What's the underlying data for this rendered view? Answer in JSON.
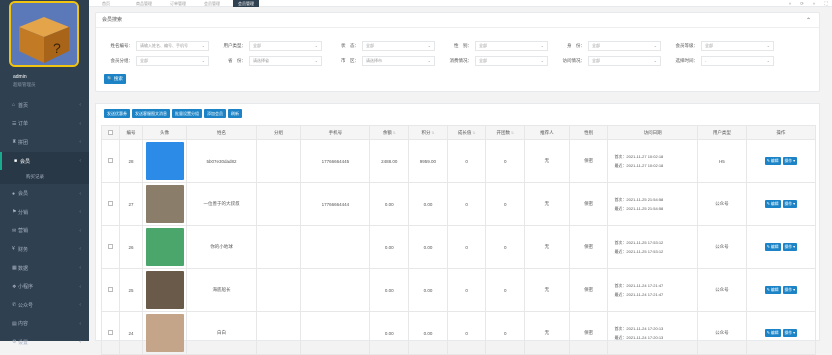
{
  "sidebar": {
    "username": "admin",
    "role": "超级管理员",
    "items": [
      {
        "label": "首页",
        "icon": "home-icon"
      },
      {
        "label": "订单",
        "icon": "order-icon"
      },
      {
        "label": "拼团",
        "icon": "group-icon"
      },
      {
        "label": "会员",
        "icon": "member-icon",
        "active": true
      },
      {
        "label": "会员",
        "icon": "user-icon"
      },
      {
        "label": "分销",
        "icon": "share-icon"
      },
      {
        "label": "营销",
        "icon": "marketing-icon"
      },
      {
        "label": "财务",
        "icon": "finance-icon"
      },
      {
        "label": "数据",
        "icon": "data-icon"
      },
      {
        "label": "小程序",
        "icon": "miniapp-icon"
      },
      {
        "label": "公众号",
        "icon": "wechat-icon"
      },
      {
        "label": "内容",
        "icon": "content-icon"
      },
      {
        "label": "设置",
        "icon": "settings-icon"
      }
    ],
    "subitem": "购买记录"
  },
  "tabs": [
    "首页",
    "商品管理",
    "订单管理",
    "会员管理",
    "会员管理"
  ],
  "search": {
    "title": "会员搜索",
    "row1": [
      {
        "label": "姓名编号：",
        "value": "请输入姓名、编号、手机号"
      },
      {
        "label": "用户类型：",
        "value": "全部"
      },
      {
        "label": "状　态：",
        "value": "全部"
      },
      {
        "label": "性　别：",
        "value": "全部"
      },
      {
        "label": "身　份：",
        "value": "全部"
      },
      {
        "label": "会员等级：",
        "value": "全部"
      }
    ],
    "row2": [
      {
        "label": "会员分组：",
        "value": "全部"
      },
      {
        "label": "省　份：",
        "value": "请选择省"
      },
      {
        "label": "市　区：",
        "value": "请选择市"
      },
      {
        "label": "消费情况：",
        "value": "全部"
      },
      {
        "label": "访问情况：",
        "value": "全部"
      },
      {
        "label": "选择时间：",
        "value": "-"
      }
    ],
    "button": "搜索"
  },
  "toolbar": [
    "发送优惠券",
    "发送客服图文消息",
    "批量设置分组",
    "添加会员",
    "刷新"
  ],
  "columns": [
    "",
    "编号",
    "头像",
    "姓名",
    "分组",
    "手机号",
    "余额",
    "积分",
    "成长值",
    "开团数",
    "推荐人",
    "性别",
    "访问日期",
    "用户类型",
    "操作"
  ],
  "rows": [
    {
      "id": "28",
      "name": "5b07e30dad82",
      "group": "",
      "phone": "17766664445",
      "balance": "2488.00",
      "points": "9959.00",
      "growth": "0",
      "groups": "0",
      "ref": "无",
      "gender": "保密",
      "first": "首次：2021-11-27 10:02:18",
      "last": "最近：2021-11-27 10:02:18",
      "type": "H5",
      "avatar": "#2b8be6"
    },
    {
      "id": "27",
      "name": "一位善于的大叔叔",
      "group": "",
      "phone": "17766664444",
      "balance": "0.00",
      "points": "0.00",
      "growth": "0",
      "groups": "0",
      "ref": "无",
      "gender": "保密",
      "first": "首次：2021-11-25 21:54:58",
      "last": "最近：2021-11-25 21:54:58",
      "type": "公众号",
      "avatar": "#8a7d6a"
    },
    {
      "id": "26",
      "name": "你的小地球",
      "group": "",
      "phone": "",
      "balance": "0.00",
      "points": "0.00",
      "growth": "0",
      "groups": "0",
      "ref": "无",
      "gender": "保密",
      "first": "首次：2021-11-25 17:53:12",
      "last": "最近：2021-11-25 17:53:12",
      "type": "公众号",
      "avatar": "#4aa66a"
    },
    {
      "id": "25",
      "name": "海底船长",
      "group": "",
      "phone": "",
      "balance": "0.00",
      "points": "0.00",
      "growth": "0",
      "groups": "0",
      "ref": "无",
      "gender": "保密",
      "first": "首次：2021-11-24 17:21:47",
      "last": "最近：2021-11-24 17:21:47",
      "type": "公众号",
      "avatar": "#6a5a4a"
    },
    {
      "id": "24",
      "name": "白白",
      "group": "",
      "phone": "",
      "balance": "0.00",
      "points": "0.00",
      "growth": "0",
      "groups": "0",
      "ref": "无",
      "gender": "保密",
      "first": "首次：2021-11-24 17:20:13",
      "last": "最近：2021-11-24 17:20:13",
      "type": "公众号",
      "avatar": "#c4a58a"
    }
  ],
  "ops": {
    "edit": "编辑",
    "more": "操作"
  }
}
